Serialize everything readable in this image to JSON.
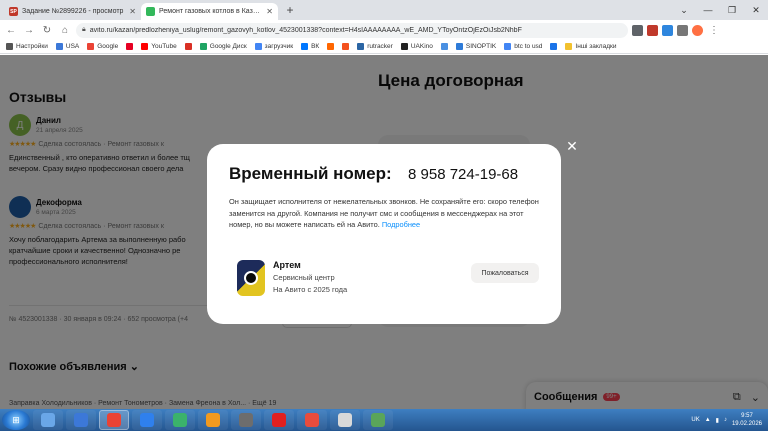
{
  "browser": {
    "tabs": [
      {
        "label": "Задание №2899226 - просмотр",
        "favicon": "SP",
        "active": false
      },
      {
        "label": "Ремонт газовых котлов в Казани",
        "favicon": "",
        "active": true
      }
    ],
    "new_tab": "+",
    "url": "avito.ru/kazan/predlozheniya_uslug/remont_gazovyh_kotlov_4523001338?context=H4sIAAAAAAAA_wE_AMD_YToyOntzOjEzOiJsb2NhbF"
  },
  "bookmarks": [
    {
      "label": "Настройки",
      "color": "#555555"
    },
    {
      "label": "USA",
      "color": "#3c78d8"
    },
    {
      "label": "Google",
      "color": "#ea4335"
    },
    {
      "label": "",
      "color": "#e60023"
    },
    {
      "label": "YouTube",
      "color": "#ff0000"
    },
    {
      "label": "",
      "color": "#d93025"
    },
    {
      "label": "Google Диск",
      "color": "#1fa463"
    },
    {
      "label": "загрузчик",
      "color": "#4285f4"
    },
    {
      "label": "ВК",
      "color": "#0077ff"
    },
    {
      "label": "",
      "color": "#f60"
    },
    {
      "label": "",
      "color": "#f4511e"
    },
    {
      "label": "rutracker",
      "color": "#2b65a4"
    },
    {
      "label": "UAKino",
      "color": "#222222"
    },
    {
      "label": "",
      "color": "#4a90e2"
    },
    {
      "label": "SINOPTIK",
      "color": "#2e7bd8"
    },
    {
      "label": "btc to usd",
      "color": "#4285f4"
    },
    {
      "label": "",
      "color": "#1a73e8"
    },
    {
      "label": "Інші закладки",
      "color": "#f2c12e"
    }
  ],
  "page": {
    "reviews_heading": "Отзывы",
    "price_heading": "Цена договорная",
    "reviews": [
      {
        "initial": "Д",
        "avatar_color": "#8bc34a",
        "name": "Данил",
        "date": "21 апреля 2025",
        "stars": "★★★★★",
        "meta": "Сделка состоялась · Ремонт газовых к",
        "text": "Единственный , кто оперативно ответил и более тщ",
        "text2": "вечером. Сразу видно профессионал своего дела"
      },
      {
        "initial": "",
        "avatar_color": "#1e5fa8",
        "name": "Декоформа",
        "date": "6 марта 2025",
        "stars": "★★★★★",
        "meta": "Сделка состоялась · Ремонт газовых к",
        "text": "Хочу поблагодарить Артема за выполненную рабо",
        "text2": "кратчайшие сроки и качественно! Однозначно ре",
        "text3": "профессионального исполнителя!"
      }
    ],
    "listing_meta": "№ 4523001338 · 30 января в 09:24 · 652 просмотра (+4",
    "similar_heading": "Похожие объявления ⌄",
    "similar_first": "Заправка Холодильников · Ремонт Тонометров · Замена Фреона в Хол... · Ещё 19"
  },
  "messages": {
    "title": "Сообщения",
    "badge": "99+"
  },
  "modal": {
    "title": "Временный номер:",
    "phone": "8 958 724-19-68",
    "description": "Он защищает исполнителя от нежелательных звонков. Не сохраняйте его: скоро телефон заменится на другой. Компания не получит смс и сообщения в мессенджерах на этот номер, но вы можете написать ей на Авито.",
    "more_link": "Подробнее",
    "seller_name": "Артем",
    "seller_type": "Сервисный центр",
    "seller_since": "На Авито с 2025 года",
    "complain_label": "Пожаловаться"
  },
  "taskbar": {
    "lang": "UK",
    "time": "9:57",
    "date": "19.02.2026",
    "apps": [
      "#6aa7e8",
      "#3c78d8",
      "#ea4335",
      "#2f80ed",
      "#3bb26b",
      "#f29a1f",
      "#6d6d6d",
      "#e02020",
      "#e84c3d",
      "#d9d9d9",
      "#5aa55a"
    ]
  }
}
